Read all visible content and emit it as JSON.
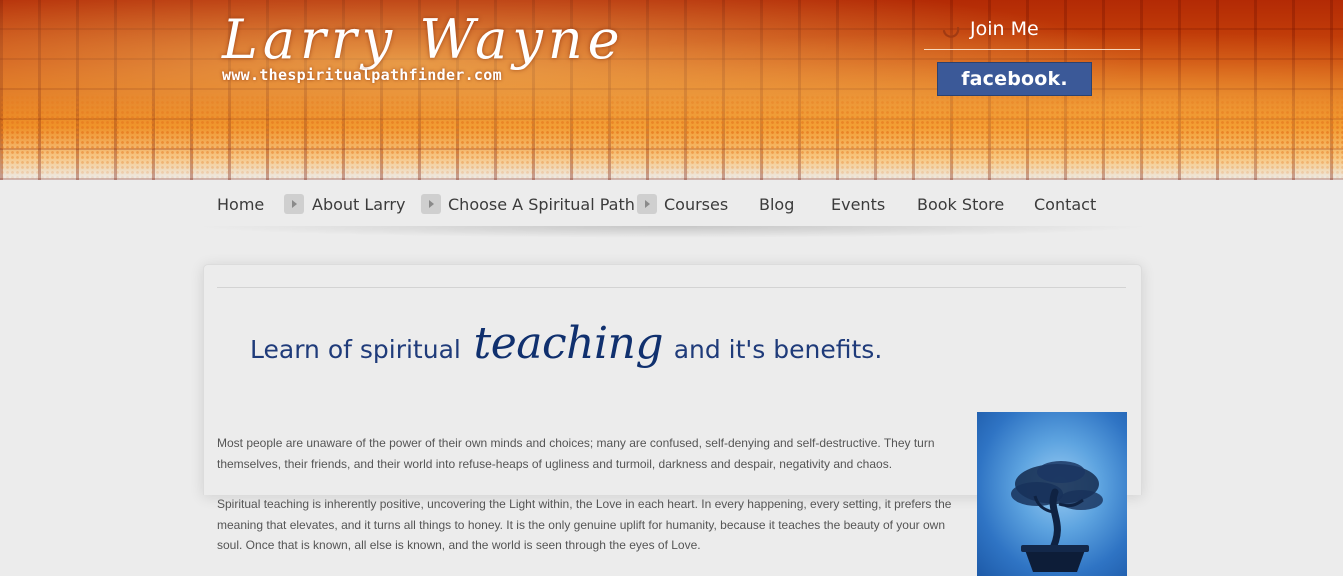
{
  "header": {
    "logo_name": "Larry Wayne",
    "logo_url": "www.thespiritualpathfinder.com",
    "join_label": "Join Me",
    "facebook_label": "facebook."
  },
  "nav": {
    "items": [
      {
        "label": "Home"
      },
      {
        "label": "About Larry"
      },
      {
        "label": "Choose A Spiritual Path"
      },
      {
        "label": "Courses"
      },
      {
        "label": "Blog"
      },
      {
        "label": "Events"
      },
      {
        "label": "Book Store"
      },
      {
        "label": "Contact"
      }
    ]
  },
  "main": {
    "headline": {
      "part1": "Learn of spiritual",
      "part2": "teaching",
      "part3": "and it's benefits."
    },
    "paragraphs": [
      "Most people are unaware of the power of their own minds and choices; many are confused, self-denying and self-destructive. They turn themselves, their friends, and their world into refuse-heaps of ugliness and turmoil, darkness and despair, negativity and chaos.",
      "Spiritual teaching is inherently positive, uncovering the Light within, the Love in each heart. In every happening, every setting, it prefers the meaning that elevates, and it turns all things to honey. It is the only genuine uplift for humanity, because it teaches the beauty of your own soul. Once that is known, all else is known, and the world is seen through the eyes of Love."
    ]
  },
  "colors": {
    "header_orange": "#cc4a0c",
    "headline_blue": "#1f3b7a",
    "facebook_blue": "#3b5998",
    "page_background": "#ececec"
  },
  "icons": {
    "join": "join-swirl-icon",
    "nav_arrow": "nav-arrow-icon"
  }
}
